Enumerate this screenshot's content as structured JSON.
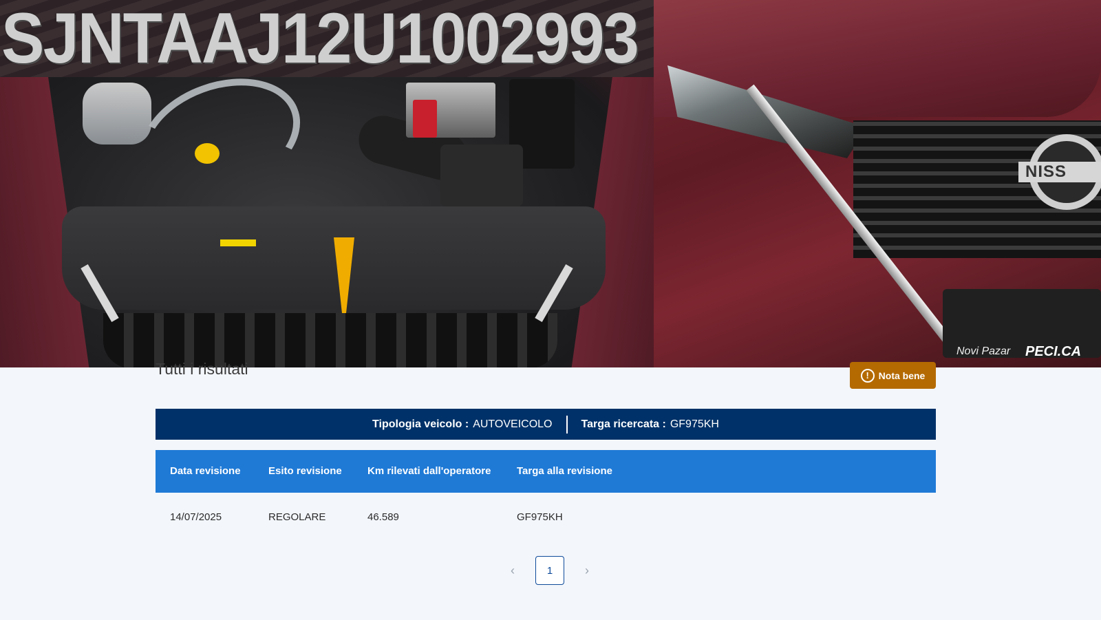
{
  "photos": {
    "vin": "SJNTAAJ12U1002993",
    "right_badge": "NISS",
    "watermark_city": "Novi Pazar",
    "watermark_brand": "PECI.CA"
  },
  "results": {
    "title": "Tutti i risultati",
    "nota_label": "Nota bene",
    "nota_icon": "!"
  },
  "vehicle": {
    "tipologia_label": "Tipologia veicolo :",
    "tipologia_value": "AUTOVEICOLO",
    "targa_label": "Targa ricercata :",
    "targa_value": "GF975KH"
  },
  "table": {
    "headers": [
      "Data revisione",
      "Esito revisione",
      "Km rilevati dall'operatore",
      "Targa alla revisione"
    ],
    "rows": [
      [
        "14/07/2025",
        "REGOLARE",
        "46.589",
        "GF975KH"
      ]
    ]
  },
  "pagination": {
    "prev": "‹",
    "current": "1",
    "next": "›"
  },
  "colors": {
    "vehicle_bar": "#003168",
    "table_header": "#1f7ad6",
    "nota_button": "#b46a00"
  }
}
